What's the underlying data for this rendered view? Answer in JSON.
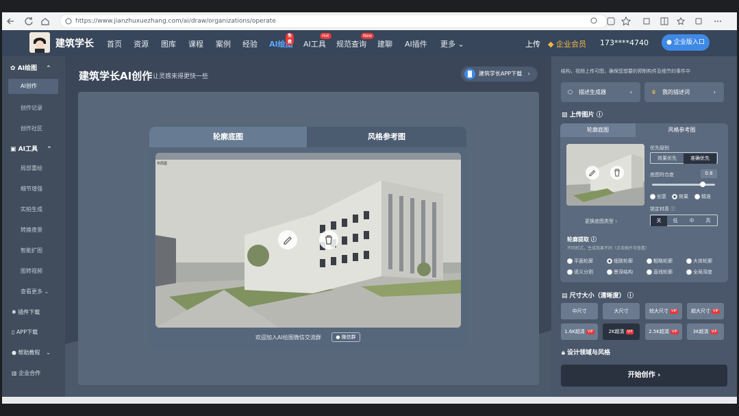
{
  "browser": {
    "url": "https://www.jianzhuxuezhang.com/ai/draw/organizations/operate"
  },
  "nav": {
    "brand": "建筑学长",
    "items": [
      {
        "label": "首页"
      },
      {
        "label": "资源"
      },
      {
        "label": "图库"
      },
      {
        "label": "课程"
      },
      {
        "label": "案例"
      },
      {
        "label": "经验"
      },
      {
        "label": "AI绘图",
        "tag": "免费"
      },
      {
        "label": "AI工具",
        "tag": "Hot"
      },
      {
        "label": "规范查询",
        "tag": "New"
      },
      {
        "label": "建聊"
      },
      {
        "label": "AI插件"
      },
      {
        "label": "更多"
      }
    ],
    "upload": "上传",
    "vip": "企业会员",
    "phone": "173****4740",
    "enterprise_btn": "企业版入口"
  },
  "sidebar": {
    "ai_draw": "AI绘图",
    "ai_create": "AI创作",
    "history": "创作记录",
    "community": "创作社区",
    "ai_tools": "AI工具",
    "tools": [
      "局部重绘",
      "细节增强",
      "实拍生成",
      "转换夜景",
      "智能扩图",
      "图转视频",
      "查看更多"
    ],
    "plugin": "插件下载",
    "app": "APP下载",
    "help": "帮助教程",
    "enterprise": "企业合作"
  },
  "main": {
    "title": "建筑学长AI创作",
    "subtitle": "让灵感来得更快一些",
    "app_btn": "建筑学长APP下载",
    "tab_outline": "轮廓底图",
    "tab_style": "风格参考图",
    "img_label": "布局图",
    "footer_text": "欢迎加入AI绘图微信交流群",
    "wx_btn": "微信群"
  },
  "panel": {
    "top_text": "结构，视频上传可图，确保您想要的预制构件及细节的事件中",
    "btn_prompt": "描述生成器",
    "btn_my": "我的描述词",
    "upload_label": "上传图片",
    "tab1": "轮廓底图",
    "tab2": "风格参考图",
    "priority_label": "优先级别",
    "priority_options": [
      "效果优先",
      "准确优先"
    ],
    "similarity_label": "底图符合度",
    "similarity_value": "0.8",
    "radio_opts": [
      "创意",
      "效果",
      "精准"
    ],
    "lock_label": "锁定材质",
    "lock_opts": [
      "关",
      "低",
      "中",
      "高"
    ],
    "replace_text": "更换底图类型",
    "outline_label": "轮廓提取",
    "outline_hint": "不同形式，生成效果不同（点击图片可查看）",
    "outline_opts": [
      "平面轮廓",
      "细致轮廓",
      "粗略轮廓",
      "大体轮廓",
      "语义分割",
      "景深结构",
      "直线轮廓",
      "全局深度"
    ],
    "size_label": "尺寸大小（清晰度）",
    "sizes": [
      "中尺寸",
      "大尺寸",
      "较大尺寸",
      "超大尺寸"
    ],
    "res": [
      "1.6K超清",
      "2K超清",
      "2.5K超清",
      "3K超清"
    ],
    "vip_tag": "VIP",
    "design_label": "设计领域与风格",
    "start_btn": "开始创作"
  }
}
